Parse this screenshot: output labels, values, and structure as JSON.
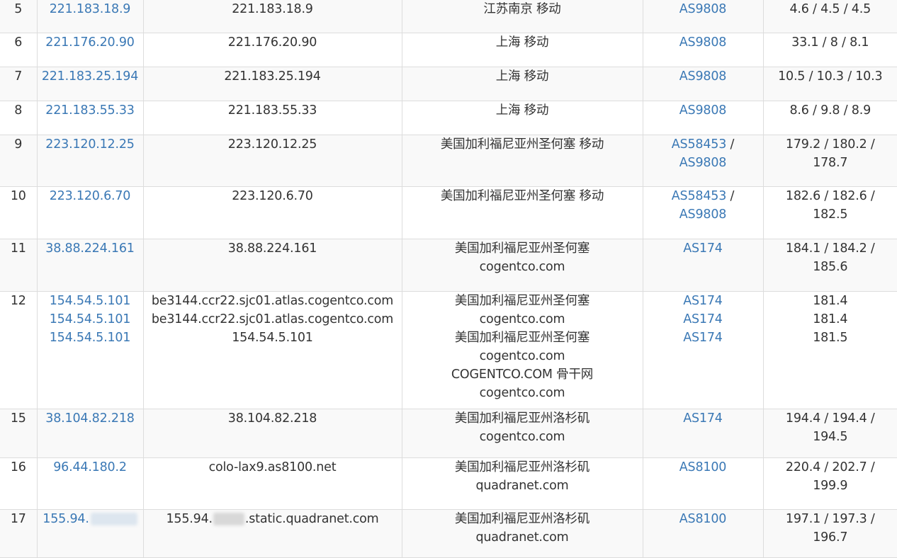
{
  "rows": [
    {
      "hop": "5",
      "ip": [
        "221.183.18.9"
      ],
      "host": [
        "221.183.18.9"
      ],
      "loc": [
        "江苏南京 移动"
      ],
      "asn": [
        [
          "AS9808"
        ]
      ],
      "rtt": [
        "4.6 / 4.5 / 4.5"
      ]
    },
    {
      "hop": "6",
      "ip": [
        "221.176.20.90"
      ],
      "host": [
        "221.176.20.90"
      ],
      "loc": [
        "上海 移动"
      ],
      "asn": [
        [
          "AS9808"
        ]
      ],
      "rtt": [
        "33.1 / 8 / 8.1"
      ]
    },
    {
      "hop": "7",
      "ip": [
        "221.183.25.194"
      ],
      "host": [
        "221.183.25.194"
      ],
      "loc": [
        "上海 移动"
      ],
      "asn": [
        [
          "AS9808"
        ]
      ],
      "rtt": [
        "10.5 / 10.3 / 10.3"
      ]
    },
    {
      "hop": "8",
      "ip": [
        "221.183.55.33"
      ],
      "host": [
        "221.183.55.33"
      ],
      "loc": [
        "上海 移动"
      ],
      "asn": [
        [
          "AS9808"
        ]
      ],
      "rtt": [
        "8.6 / 9.8 / 8.9"
      ]
    },
    {
      "hop": "9",
      "ip": [
        "223.120.12.25"
      ],
      "host": [
        "223.120.12.25"
      ],
      "loc": [
        "美国加利福尼亚州圣何塞 移动"
      ],
      "asn": [
        [
          "AS58453",
          " /"
        ],
        [
          "AS9808"
        ]
      ],
      "rtt": [
        "179.2 / 180.2 /",
        "178.7"
      ]
    },
    {
      "hop": "10",
      "ip": [
        "223.120.6.70"
      ],
      "host": [
        "223.120.6.70"
      ],
      "loc": [
        "美国加利福尼亚州圣何塞 移动"
      ],
      "asn": [
        [
          "AS58453",
          " /"
        ],
        [
          "AS9808"
        ]
      ],
      "rtt": [
        "182.6 / 182.6 /",
        "182.5"
      ]
    },
    {
      "hop": "11",
      "ip": [
        "38.88.224.161"
      ],
      "host": [
        "38.88.224.161"
      ],
      "loc": [
        "美国加利福尼亚州圣何塞",
        "cogentco.com"
      ],
      "asn": [
        [
          "AS174"
        ]
      ],
      "rtt": [
        "184.1 / 184.2 /",
        "185.6"
      ]
    },
    {
      "hop": "12",
      "ip": [
        "154.54.5.101",
        "154.54.5.101",
        "154.54.5.101"
      ],
      "host": [
        "be3144.ccr22.sjc01.atlas.cogentco.com",
        "be3144.ccr22.sjc01.atlas.cogentco.com",
        "154.54.5.101"
      ],
      "loc": [
        "美国加利福尼亚州圣何塞",
        "cogentco.com",
        "美国加利福尼亚州圣何塞",
        "cogentco.com",
        "COGENTCO.COM 骨干网",
        "cogentco.com"
      ],
      "asn": [
        [
          "AS174"
        ],
        [
          "AS174"
        ],
        [
          "AS174"
        ]
      ],
      "rtt": [
        "181.4",
        "181.4",
        "181.5"
      ]
    },
    {
      "hop": "15",
      "ip": [
        "38.104.82.218"
      ],
      "host": [
        "38.104.82.218"
      ],
      "loc": [
        "美国加利福尼亚州洛杉矶",
        "cogentco.com"
      ],
      "asn": [
        [
          "AS174"
        ]
      ],
      "rtt": [
        "194.4 / 194.4 /",
        "194.5"
      ]
    },
    {
      "hop": "16",
      "ip": [
        "96.44.180.2"
      ],
      "host": [
        "colo-lax9.as8100.net"
      ],
      "loc": [
        "美国加利福尼亚州洛杉矶",
        "quadranet.com"
      ],
      "asn": [
        [
          "AS8100"
        ]
      ],
      "rtt": [
        "220.4 / 202.7 /",
        "199.9"
      ]
    },
    {
      "hop": "17",
      "ip": [
        "155.94."
      ],
      "host": [
        "155.94.",
        ".static.quadranet.com"
      ],
      "loc": [
        "美国加利福尼亚州洛杉矶",
        "quadranet.com"
      ],
      "asn": [
        [
          "AS8100"
        ]
      ],
      "rtt": [
        "197.1 / 197.3 /",
        "196.7"
      ]
    }
  ]
}
